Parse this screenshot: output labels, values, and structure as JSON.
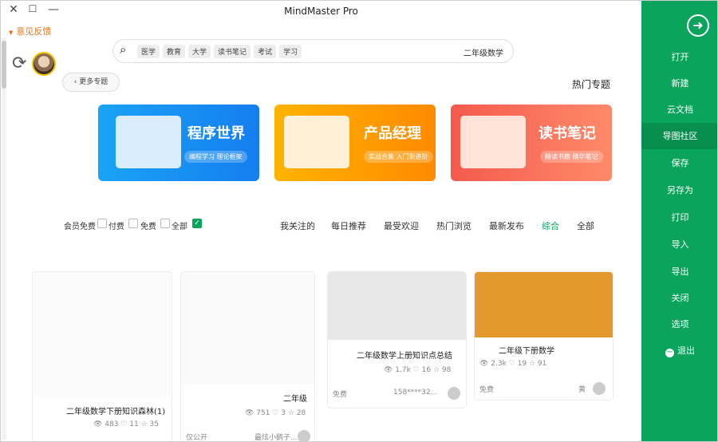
{
  "window": {
    "title": "MindMaster Pro",
    "feedback": "意见反馈",
    "minimize": "—",
    "maximize": "☐",
    "close": "✕"
  },
  "search": {
    "placeholder": "二年级数学",
    "tags": [
      "学习",
      "考试",
      "读书笔记",
      "大学",
      "教育",
      "医学"
    ]
  },
  "hot": {
    "title": "热门专题",
    "more": "更多专题"
  },
  "banners": [
    {
      "title": "读书笔记",
      "sub": "精读书籍 精华笔记"
    },
    {
      "title": "产品经理",
      "sub": "实战合集 入门到进阶"
    },
    {
      "title": "程序世界",
      "sub": "编程学习 理论框架"
    }
  ],
  "filters": [
    "全部",
    "综合",
    "最新发布",
    "热门浏览",
    "最受欢迎",
    "每日推荐",
    "我关注的"
  ],
  "checks": [
    "全部",
    "免费",
    "付费",
    "会员免费"
  ],
  "cards": [
    {
      "title": "二年级下册数学",
      "views": "2.3k",
      "likes": "19",
      "favs": "91",
      "author": "黄",
      "price": "免费"
    },
    {
      "title": "二年级数学上册知识点总结",
      "views": "1.7k",
      "likes": "16",
      "favs": "98",
      "author": "158****32...",
      "price": "免费"
    },
    {
      "title": "二年级",
      "views": "751",
      "likes": "3",
      "favs": "28",
      "author": "最炫小鹅子...",
      "price": "仅公开"
    },
    {
      "title": "二年级数学下册知识森林(1)",
      "views": "483",
      "likes": "11",
      "favs": "35"
    }
  ],
  "sidebar": {
    "items": [
      "打开",
      "新建",
      "云文档",
      "导图社区",
      "保存",
      "另存为",
      "打印",
      "导入",
      "导出",
      "关闭",
      "选项",
      "退出"
    ]
  },
  "colors": {
    "green": "#0aa45d",
    "orange": "#e0761e"
  }
}
